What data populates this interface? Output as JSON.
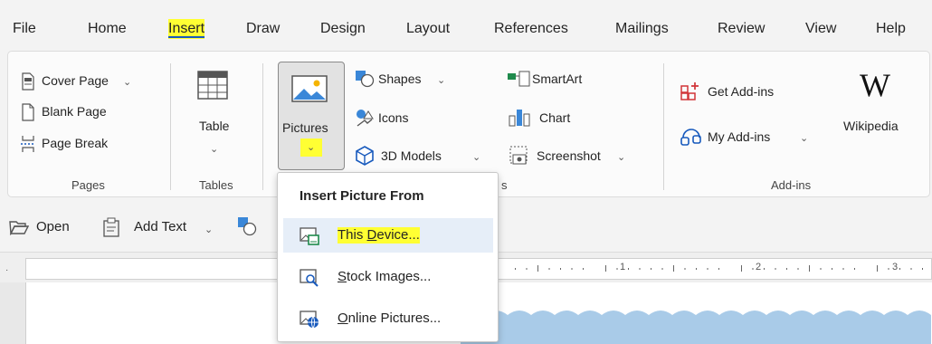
{
  "tabs": [
    "File",
    "Home",
    "Insert",
    "Draw",
    "Design",
    "Layout",
    "References",
    "Mailings",
    "Review",
    "View",
    "Help"
  ],
  "active_tab": "Insert",
  "pages_group": {
    "label": "Pages",
    "items": [
      {
        "label": "Cover Page",
        "icon": "cover-page-icon"
      },
      {
        "label": "Blank Page",
        "icon": "blank-page-icon"
      },
      {
        "label": "Page Break",
        "icon": "page-break-icon"
      }
    ]
  },
  "tables_group": {
    "label": "Tables",
    "table_label": "Table"
  },
  "illustrations_group": {
    "pictures_label": "Pictures",
    "shapes_label": "Shapes",
    "icons_label": "Icons",
    "models_label": "3D Models",
    "smartart_label": "SmartArt",
    "chart_label": "Chart",
    "screenshot_label": "Screenshot",
    "group_label_fragment": "s"
  },
  "addins_group": {
    "label": "Add-ins",
    "get_label": "Get Add-ins",
    "my_label": "My Add-ins",
    "wiki_label": "Wikipedia",
    "wiki_logo": "W"
  },
  "toolbar": {
    "open_label": "Open",
    "add_text_label": "Add Text"
  },
  "ruler": {
    "marks": [
      "1",
      "2",
      "3"
    ]
  },
  "menu": {
    "title": "Insert Picture From",
    "items": [
      {
        "label_hotkey": "D",
        "label_before": "This ",
        "label_after": "evice...",
        "icon": "this-device-icon",
        "highlighted": true
      },
      {
        "label_hotkey": "S",
        "label_before": "",
        "label_after": "tock Images...",
        "icon": "stock-images-icon",
        "highlighted": false
      },
      {
        "label_hotkey": "O",
        "label_before": "",
        "label_after": "nline Pictures...",
        "icon": "online-pictures-icon",
        "highlighted": false
      }
    ]
  },
  "colors": {
    "highlight": "#ffff33",
    "accent": "#185abd",
    "hover": "#e6eef8",
    "addins_red": "#d13438"
  }
}
